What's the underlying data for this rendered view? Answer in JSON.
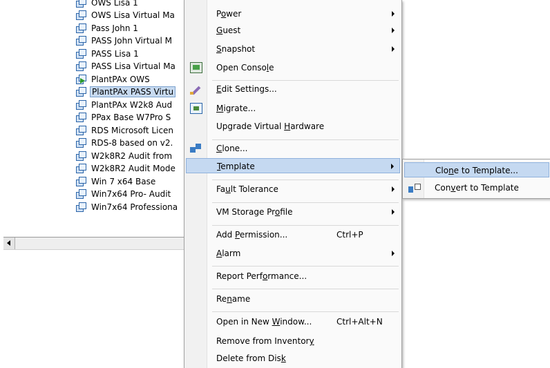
{
  "tree": {
    "items": [
      {
        "label": "OWS Lisa 1",
        "icon": "vm-icon",
        "state": "off"
      },
      {
        "label": "OWS Lisa Virtual Ma",
        "icon": "vm-icon",
        "state": "off"
      },
      {
        "label": "Pass John 1",
        "icon": "vm-icon",
        "state": "off"
      },
      {
        "label": "PASS John Virtual M",
        "icon": "vm-icon",
        "state": "off"
      },
      {
        "label": "PASS Lisa 1",
        "icon": "vm-icon",
        "state": "off"
      },
      {
        "label": "PASS Lisa Virtual Ma",
        "icon": "vm-icon",
        "state": "off"
      },
      {
        "label": "PlantPAx OWS",
        "icon": "vm-powered-on-icon",
        "state": "on"
      },
      {
        "label": "PlantPAx PASS Virtu",
        "icon": "vm-icon",
        "state": "off",
        "selected": true
      },
      {
        "label": "PlantPAx W2k8 Aud",
        "icon": "vm-icon",
        "state": "off"
      },
      {
        "label": "PPax Base W7Pro S",
        "icon": "vm-icon",
        "state": "off"
      },
      {
        "label": "RDS Microsoft Licen",
        "icon": "vm-icon",
        "state": "off"
      },
      {
        "label": "RDS-8 based on v2.",
        "icon": "vm-icon",
        "state": "off"
      },
      {
        "label": "W2k8R2 Audit from",
        "icon": "vm-icon",
        "state": "off"
      },
      {
        "label": "W2k8R2 Audit Mode",
        "icon": "vm-icon",
        "state": "off"
      },
      {
        "label": "Win 7 x64 Base",
        "icon": "vm-icon",
        "state": "off"
      },
      {
        "label": "Win7x64 Pro- Audit",
        "icon": "vm-icon",
        "state": "off"
      },
      {
        "label": "Win7x64 Professiona",
        "icon": "vm-icon",
        "state": "off"
      }
    ]
  },
  "context_menu": {
    "items": [
      {
        "pre": "P",
        "u": "o",
        "post": "wer",
        "submenu": true
      },
      {
        "pre": "",
        "u": "G",
        "post": "uest",
        "submenu": true
      },
      {
        "pre": "",
        "u": "S",
        "post": "napshot",
        "submenu": true
      },
      {
        "pre": "Open Conso",
        "u": "l",
        "post": "e",
        "icon": "console-icon"
      },
      {
        "pre": "",
        "u": "E",
        "post": "dit Settings...",
        "icon": "edit-settings-icon"
      },
      {
        "pre": "",
        "u": "M",
        "post": "igrate...",
        "icon": "migrate-icon"
      },
      {
        "pre": "Upgrade Virtual ",
        "u": "H",
        "post": "ardware"
      },
      {
        "pre": "",
        "u": "C",
        "post": "lone...",
        "icon": "clone-icon"
      },
      {
        "pre": "",
        "u": "T",
        "post": "emplate",
        "submenu": true,
        "highlighted": true
      },
      {
        "pre": "Fa",
        "u": "u",
        "post": "lt Tolerance",
        "submenu": true
      },
      {
        "pre": "VM Storage Pr",
        "u": "o",
        "post": "file",
        "submenu": true
      },
      {
        "pre": "Add ",
        "u": "P",
        "post": "ermission...",
        "shortcut": "Ctrl+P"
      },
      {
        "pre": "",
        "u": "A",
        "post": "larm",
        "submenu": true
      },
      {
        "pre": "Report Perf",
        "u": "o",
        "post": "rmance..."
      },
      {
        "pre": "Re",
        "u": "n",
        "post": "ame"
      },
      {
        "pre": "Open in New ",
        "u": "W",
        "post": "indow...",
        "shortcut": "Ctrl+Alt+N"
      },
      {
        "pre": "Remove from Inventor",
        "u": "y",
        "post": ""
      },
      {
        "pre": "Delete from Dis",
        "u": "k",
        "post": ""
      }
    ]
  },
  "template_submenu": {
    "items": [
      {
        "pre": "Clo",
        "u": "n",
        "post": "e to Template...",
        "highlighted": true
      },
      {
        "pre": "Con",
        "u": "v",
        "post": "ert to Template",
        "icon": "convert-template-icon"
      }
    ]
  }
}
